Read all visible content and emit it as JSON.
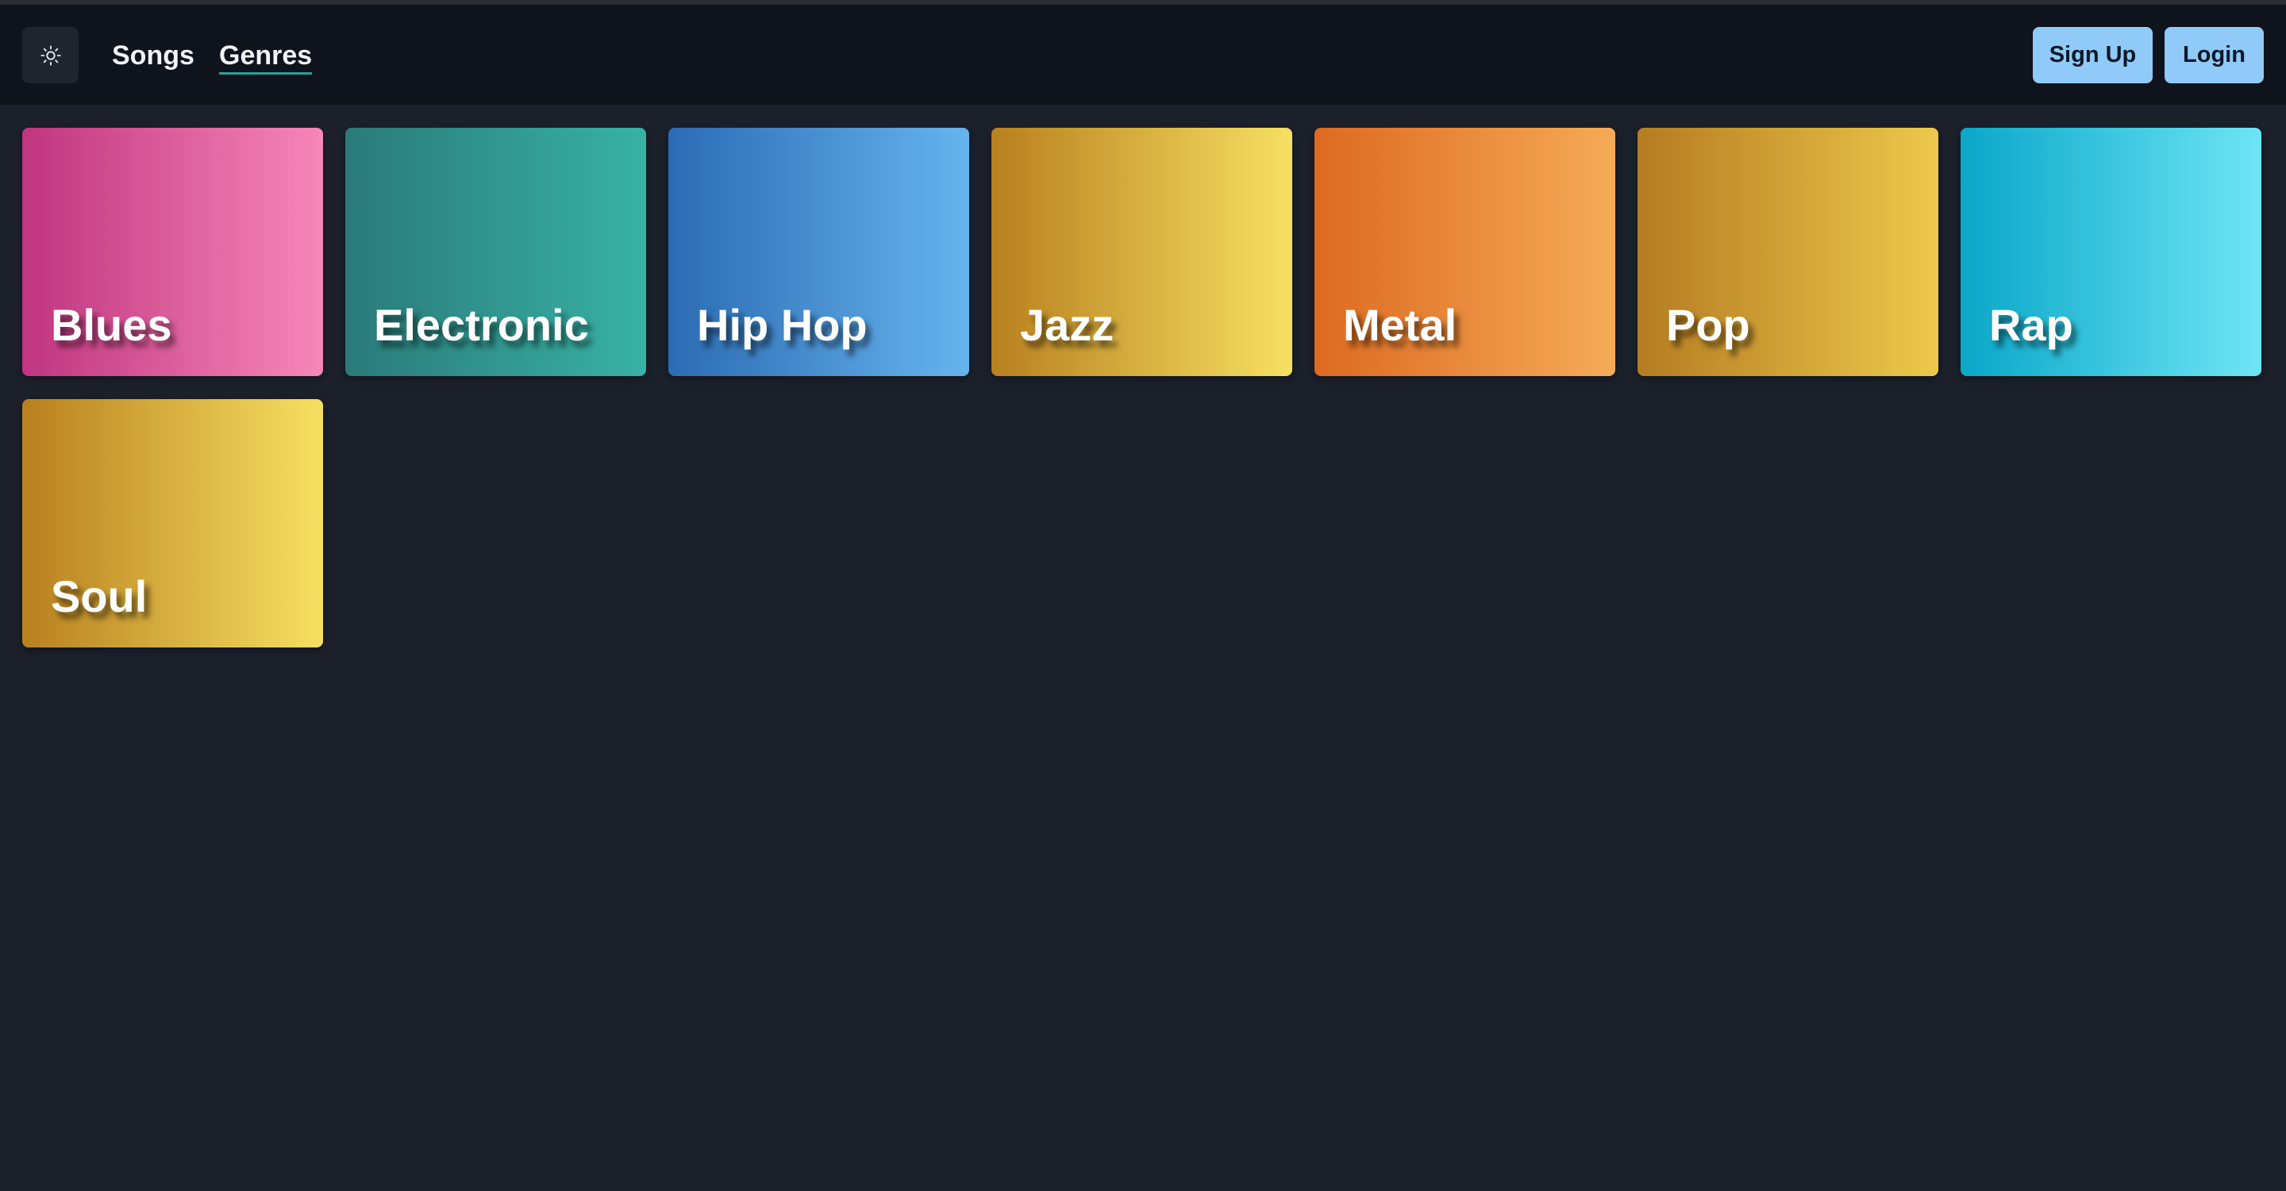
{
  "navbar": {
    "theme_toggle_icon": "sun-icon",
    "links": {
      "songs": "Songs",
      "genres": "Genres"
    },
    "signup_label": "Sign Up",
    "login_label": "Login",
    "active_link": "Genres",
    "colors": {
      "background": "#0f131b",
      "button": "#90caf9",
      "active_underline": "#2aa198"
    }
  },
  "genres": [
    {
      "name": "Blues",
      "gradient": [
        "#c0357f",
        "#f687b8"
      ]
    },
    {
      "name": "Electronic",
      "gradient": [
        "#2a7a78",
        "#38b2a6"
      ]
    },
    {
      "name": "Hip Hop",
      "gradient": [
        "#2b6bb3",
        "#66b4ee"
      ]
    },
    {
      "name": "Jazz",
      "gradient": [
        "#b8801f",
        "#f6e062"
      ]
    },
    {
      "name": "Metal",
      "gradient": [
        "#dd6a20",
        "#f5ab58"
      ]
    },
    {
      "name": "Pop",
      "gradient": [
        "#b57c22",
        "#ecc94b"
      ]
    },
    {
      "name": "Rap",
      "gradient": [
        "#0aa7c9",
        "#6ee5f4"
      ]
    },
    {
      "name": "Soul",
      "gradient": [
        "#b8801f",
        "#f6e062"
      ]
    }
  ]
}
